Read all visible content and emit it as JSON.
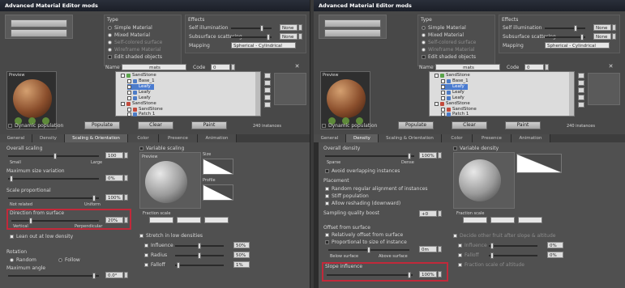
{
  "window_title": "Advanced Material Editor mods",
  "colors": {
    "highlight": "#c2293a",
    "selection": "#4a7bd0",
    "titlebar": "#1b1f28"
  },
  "common": {
    "type_label": "Type",
    "type_options": [
      "Simple Material",
      "Mixed Material",
      "Self-colored surface",
      "Wireframe Material",
      "Edit shaded objects"
    ],
    "effects_label": "Effects",
    "effects_rows": [
      "Self illumination",
      "Subsurface scattering",
      "Mapping"
    ],
    "effects_values": [
      "None",
      "None"
    ],
    "mapping_value": "Spherical - Cylindrical",
    "name_label": "Name",
    "name_value": "mats",
    "code_label": "Code",
    "code_value": "0",
    "preview_label": "Preview",
    "tree": [
      {
        "label": "SandStone",
        "sel": false,
        "indent": 0,
        "icon": "green"
      },
      {
        "label": "Base_1",
        "sel": false,
        "indent": 1,
        "icon": "blue"
      },
      {
        "label": "Leafy",
        "sel": true,
        "indent": 1,
        "icon": "blue"
      },
      {
        "label": "Leafy",
        "sel": false,
        "indent": 1,
        "icon": "blue"
      },
      {
        "label": "Leafy",
        "sel": false,
        "indent": 1,
        "icon": "blue"
      },
      {
        "label": "SandStone",
        "sel": false,
        "indent": 0,
        "icon": "red"
      },
      {
        "label": "SandStone",
        "sel": false,
        "indent": 1,
        "icon": "red"
      },
      {
        "label": "Patch 1",
        "sel": false,
        "indent": 1,
        "icon": "blue"
      }
    ],
    "dynamic_population": "Dynamic population",
    "buttons": [
      "Populate",
      "Clear",
      "Paint"
    ],
    "instances_text": "240 instances",
    "tabs": [
      "General",
      "Density",
      "Scaling & Orientation",
      "Color",
      "Presence",
      "Animation"
    ]
  },
  "left": {
    "active_tab": 2,
    "overall_scaling": "Overall scaling",
    "overall_scaling_value": "100",
    "scale_small": "Small",
    "scale_large": "Large",
    "max_variation": "Maximum size variation",
    "max_variation_value": "0%",
    "scale_by_density": "Scale proportional",
    "scale_by_density_value": "100%",
    "scale_by_density_ends": [
      "Not related",
      "Uniform"
    ],
    "direction_label": "Direction from surface",
    "direction_value": "20%",
    "direction_ends": [
      "Vertical",
      "Perpendicular"
    ],
    "lean_out": "Lean out at low density",
    "rotation_label": "Rotation",
    "rotation_opts": [
      "Random",
      "Follow"
    ],
    "max_angle_label": "Maximum angle",
    "max_angle_value": "0.0°",
    "variable_scaling": "Variable scaling",
    "preview_label": "Preview",
    "size_label": "Size",
    "variable_profile": "Profile",
    "fraction_scale": "Fraction scale",
    "stretch_label": "Stretch in low densities",
    "stretch_rows": [
      "Influence",
      "Radius",
      "Falloff"
    ],
    "stretch_values": [
      "50%",
      "50%",
      "1%"
    ]
  },
  "right": {
    "active_tab": 1,
    "overall_density": "Overall density",
    "overall_density_value": "100%",
    "density_ends": [
      "Sparse",
      "Dense"
    ],
    "avoid_overlap": "Avoid overlapping instances",
    "placement_label": "Placement",
    "placement_opts": [
      "Random regular alignment of instances",
      "Stiff population",
      "Allow reshading (downward)"
    ],
    "sampling_label": "Sampling quality boost",
    "sampling_value": "+0",
    "offset_label": "Offset from surface",
    "offset_opts": [
      "Relatively offset from surface",
      "Proportional to size of instance"
    ],
    "offset_ends": [
      "Below surface",
      "Above surface"
    ],
    "offset_value": "0m",
    "influence_label": "Slope influence",
    "influence_value": "100%",
    "variable_density": "Variable density",
    "profile_label": "Profile",
    "fraction_scale": "Fraction scale",
    "sub_label": "Decide other fruit after slope & altitude",
    "sub_rows": [
      "Influence",
      "Falloff"
    ],
    "sub_values": [
      "0%",
      "0%"
    ],
    "sub_last": "Fraction scale of altitude"
  }
}
